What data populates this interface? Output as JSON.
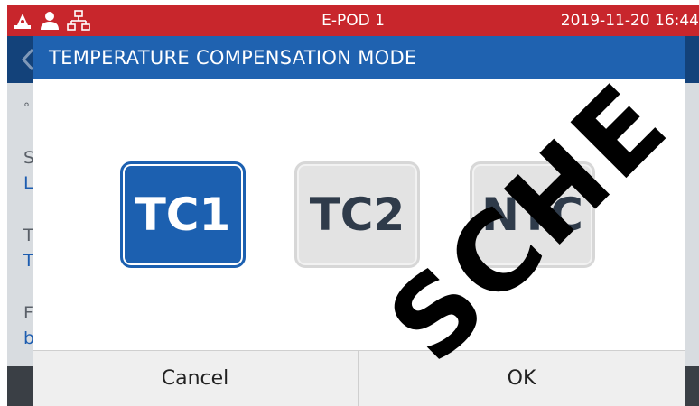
{
  "status_bar": {
    "title": "E-POD 1",
    "datetime": "2019-11-20   16:44",
    "icons": [
      "alarm-beacon-icon",
      "user-icon",
      "network-icon"
    ]
  },
  "dialog": {
    "title": "TEMPERATURE COMPENSATION MODE",
    "options": [
      {
        "label": "TC1",
        "selected": true
      },
      {
        "label": "TC2",
        "selected": false
      },
      {
        "label": "NTC",
        "selected": false
      }
    ],
    "cancel_label": "Cancel",
    "ok_label": "OK"
  },
  "watermark": {
    "text": "SCHE"
  },
  "colors": {
    "status_bar_bg": "#c8262c",
    "dialog_title_bg": "#1f62b0",
    "selected_option": "#1c60b0"
  }
}
